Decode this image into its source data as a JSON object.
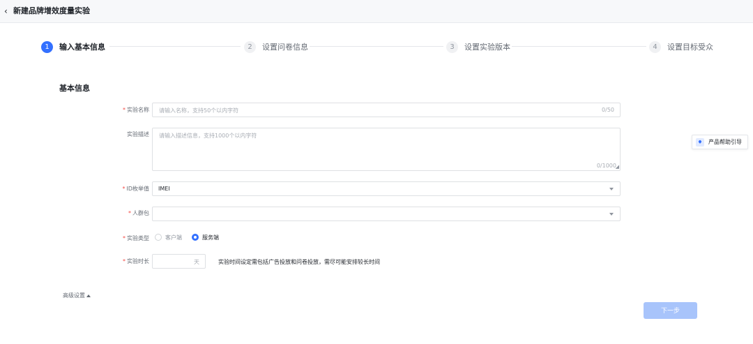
{
  "header": {
    "title": "新建品牌增效度量实验"
  },
  "steps": [
    {
      "num": "1",
      "label": "输入基本信息",
      "active": true
    },
    {
      "num": "2",
      "label": "设置问卷信息",
      "active": false
    },
    {
      "num": "3",
      "label": "设置实验版本",
      "active": false
    },
    {
      "num": "4",
      "label": "设置目标受众",
      "active": false
    }
  ],
  "section": {
    "title": "基本信息"
  },
  "form": {
    "name": {
      "label": "实验名称",
      "required": "*",
      "placeholder": "请输入名称，支持50个以内字符",
      "counter": "0/50"
    },
    "description": {
      "label": "实验描述",
      "placeholder": "请输入描述信息，支持1000个以内字符",
      "counter": "0/1000"
    },
    "id_type": {
      "label": "ID枚举值",
      "required": "*",
      "value": "IMEI"
    },
    "audience": {
      "label": "人群包",
      "required": "*",
      "value": ""
    },
    "type": {
      "label": "实验类型",
      "required": "*",
      "options": [
        "客户端",
        "服务端"
      ],
      "selected": "服务端"
    },
    "duration": {
      "label": "实验时长",
      "required": "*",
      "unit": "天",
      "note": "实验时间设定需包括广告投放和问卷投放，需尽可能安排较长时间"
    }
  },
  "advanced": {
    "label": "高级设置"
  },
  "actions": {
    "next_label": "下一步"
  },
  "help": {
    "label": "产品帮助引导"
  },
  "colors": {
    "primary": "#3370ff",
    "disabled_primary": "#a8c4fb",
    "required": "#f54a45"
  }
}
